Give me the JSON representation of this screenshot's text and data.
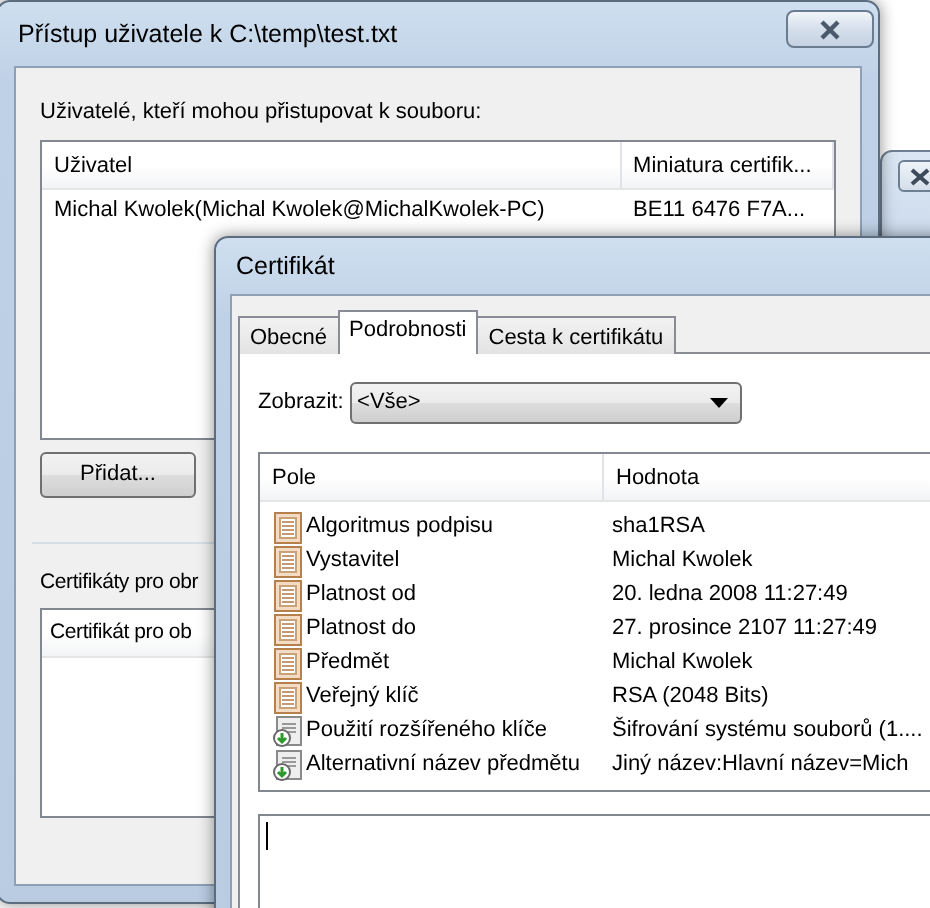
{
  "back_window": {
    "title": "Přístup uživatele k C:\\temp\\test.txt",
    "users_label": "Uživatelé, kteří mohou přistupovat k souboru:",
    "users_table": {
      "columns": [
        "Uživatel",
        "Miniatura certifik..."
      ],
      "rows": [
        [
          "Michal Kwolek(Michal Kwolek@MichalKwolek-PC)",
          "BE11 6476 F7A..."
        ]
      ]
    },
    "add_button": "Přidat...",
    "recovery_label": "Certifikáty pro obr",
    "recovery_table": {
      "columns": [
        "Certifikát pro ob"
      ]
    }
  },
  "cert_window": {
    "title": "Certifikát",
    "tabs": [
      {
        "label": "Obecné",
        "selected": false
      },
      {
        "label": "Podrobnosti",
        "selected": true
      },
      {
        "label": "Cesta k certifikátu",
        "selected": false
      }
    ],
    "show_label": "Zobrazit:",
    "show_value": "<Vše>",
    "fields_table": {
      "columns": [
        "Pole",
        "Hodnota"
      ],
      "rows": [
        {
          "kind": "field",
          "field": "Algoritmus podpisu",
          "value": "sha1RSA"
        },
        {
          "kind": "field",
          "field": "Vystavitel",
          "value": "Michal Kwolek"
        },
        {
          "kind": "field",
          "field": "Platnost od",
          "value": "20. ledna 2008 11:27:49"
        },
        {
          "kind": "field",
          "field": "Platnost do",
          "value": "27. prosince 2107 11:27:49"
        },
        {
          "kind": "field",
          "field": "Předmět",
          "value": "Michal Kwolek"
        },
        {
          "kind": "field",
          "field": "Veřejný klíč",
          "value": "RSA (2048 Bits)"
        },
        {
          "kind": "extension",
          "field": "Použití rozšířeného klíče",
          "value": "Šifrování systému souborů (1...."
        },
        {
          "kind": "extension",
          "field": "Alternativní název předmětu",
          "value": "Jiný název:Hlavní název=Mich"
        }
      ]
    }
  }
}
